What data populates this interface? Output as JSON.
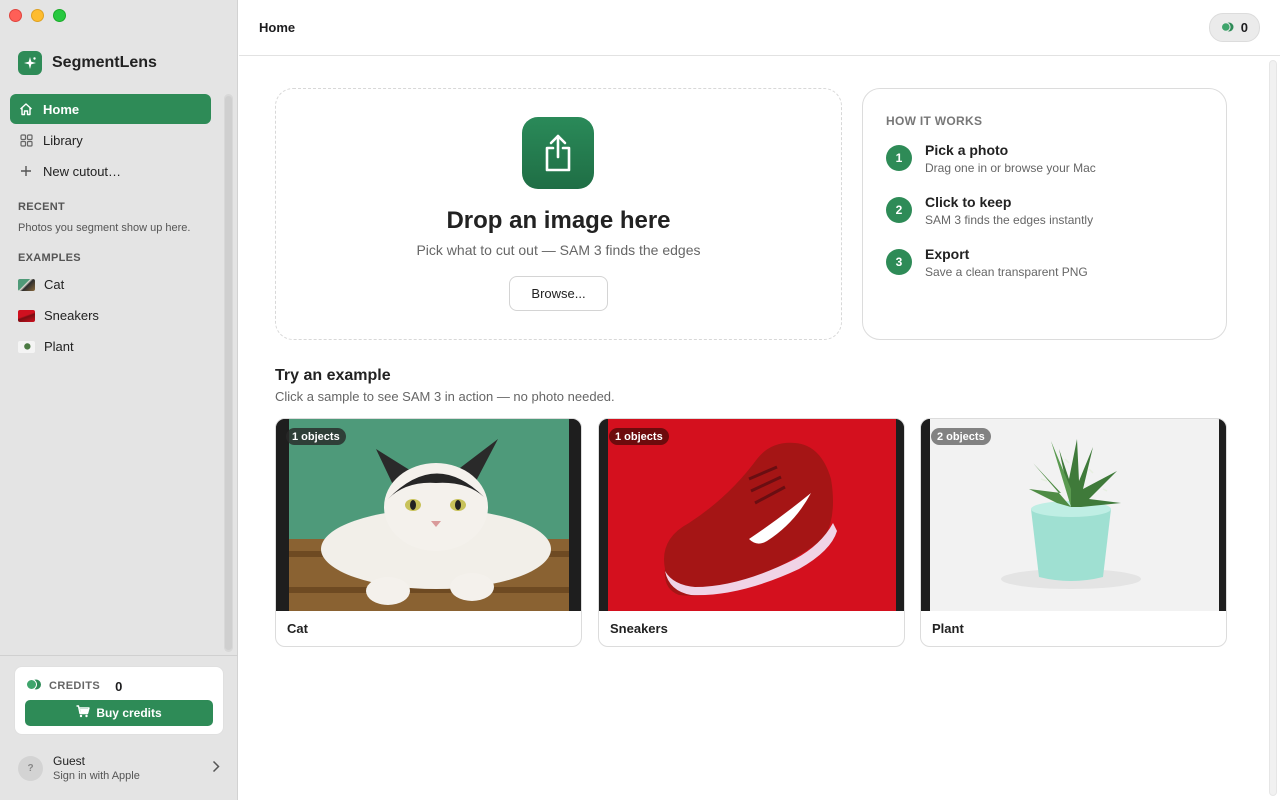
{
  "app": {
    "name": "SegmentLens"
  },
  "sidebar": {
    "nav": [
      {
        "label": "Home",
        "icon": "house-icon",
        "active": true
      },
      {
        "label": "Library",
        "icon": "grid-icon"
      },
      {
        "label": "New cutout…",
        "icon": "plus-icon"
      }
    ],
    "recent": {
      "title": "RECENT",
      "empty_text": "Photos you segment show up here."
    },
    "examples": {
      "title": "EXAMPLES",
      "items": [
        {
          "label": "Cat"
        },
        {
          "label": "Sneakers"
        },
        {
          "label": "Plant"
        }
      ]
    },
    "credits": {
      "label": "CREDITS",
      "value": "0",
      "buy_label": "Buy credits"
    },
    "user": {
      "avatar": "?",
      "name": "Guest",
      "subtitle": "Sign in with Apple"
    }
  },
  "header": {
    "title": "Home",
    "credits_value": "0"
  },
  "drop": {
    "title": "Drop an image here",
    "subtitle": "Pick what to cut out — SAM 3 finds the edges",
    "browse_label": "Browse..."
  },
  "how_it_works": {
    "title": "HOW IT WORKS",
    "steps": [
      {
        "num": "1",
        "title": "Pick a photo",
        "subtitle": "Drag one in or browse your Mac"
      },
      {
        "num": "2",
        "title": "Click to keep",
        "subtitle": "SAM 3 finds the edges instantly"
      },
      {
        "num": "3",
        "title": "Export",
        "subtitle": "Save a clean transparent PNG"
      }
    ]
  },
  "examples": {
    "title": "Try an example",
    "subtitle": "Click a sample to see SAM 3 in action — no photo needed.",
    "cards": [
      {
        "label": "Cat",
        "badge": "1 objects"
      },
      {
        "label": "Sneakers",
        "badge": "1 objects"
      },
      {
        "label": "Plant",
        "badge": "2 objects"
      }
    ]
  },
  "colors": {
    "accent": "#2e8b57",
    "sidebar_bg": "#e4e4e4"
  }
}
